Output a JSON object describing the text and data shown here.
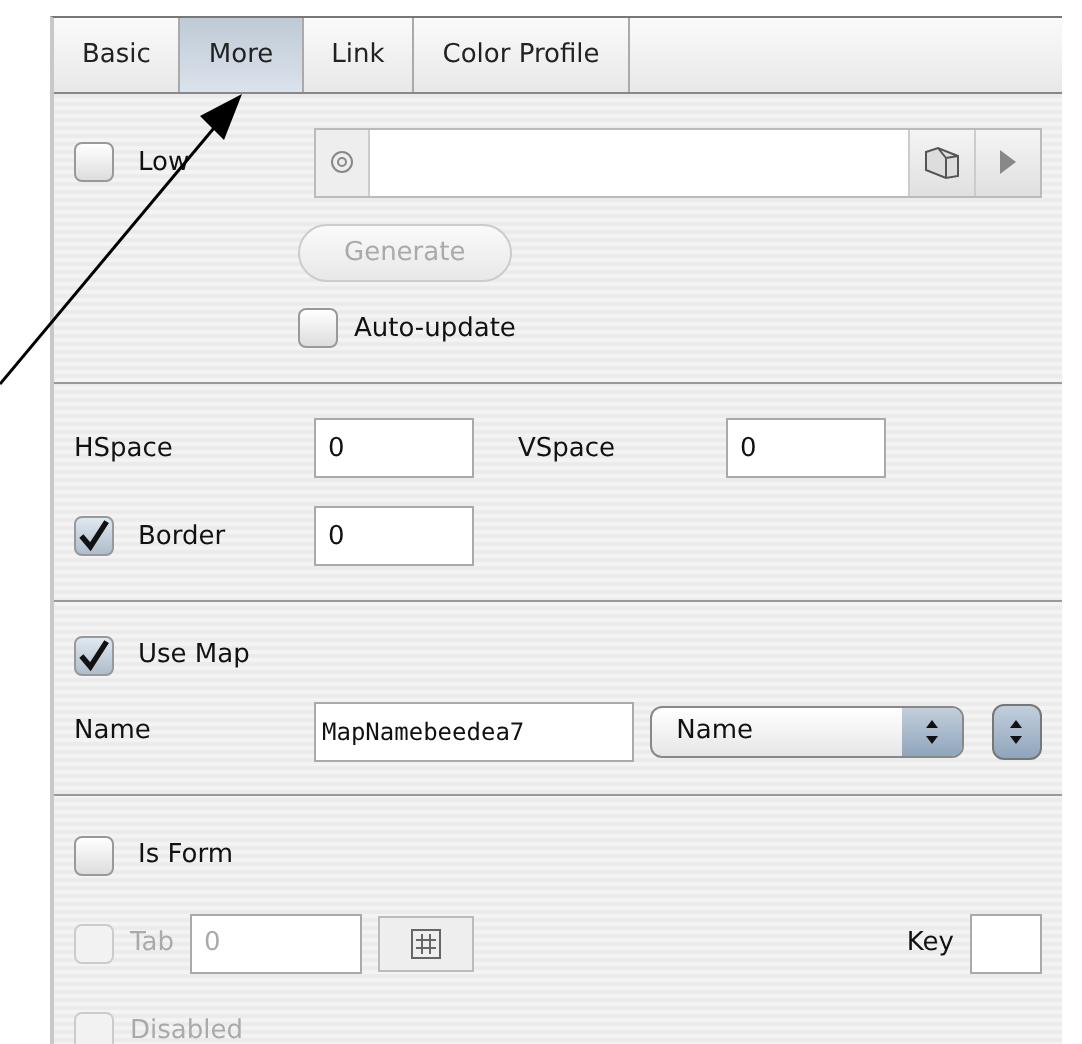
{
  "tabs": [
    {
      "label": "Basic",
      "selected": false
    },
    {
      "label": "More",
      "selected": true
    },
    {
      "label": "Link",
      "selected": false
    },
    {
      "label": "Color Profile",
      "selected": false
    }
  ],
  "low": {
    "label": "Low",
    "checked": false
  },
  "generate": {
    "label": "Generate",
    "disabled": true
  },
  "auto_update": {
    "label": "Auto-update",
    "checked": false
  },
  "hspace": {
    "label": "HSpace",
    "value": "0"
  },
  "vspace": {
    "label": "VSpace",
    "value": "0"
  },
  "border": {
    "label": "Border",
    "checked": true,
    "value": "0"
  },
  "use_map": {
    "label": "Use Map",
    "checked": true
  },
  "map_name": {
    "label": "Name",
    "value": "MapNamebeedea7",
    "select": "Name"
  },
  "is_form": {
    "label": "Is Form",
    "checked": false
  },
  "tab_index": {
    "label": "Tab",
    "checked": false,
    "disabled": true,
    "value": "0"
  },
  "key": {
    "label": "Key"
  },
  "disabled_option": {
    "label": "Disabled",
    "checked": false,
    "disabled": true
  }
}
